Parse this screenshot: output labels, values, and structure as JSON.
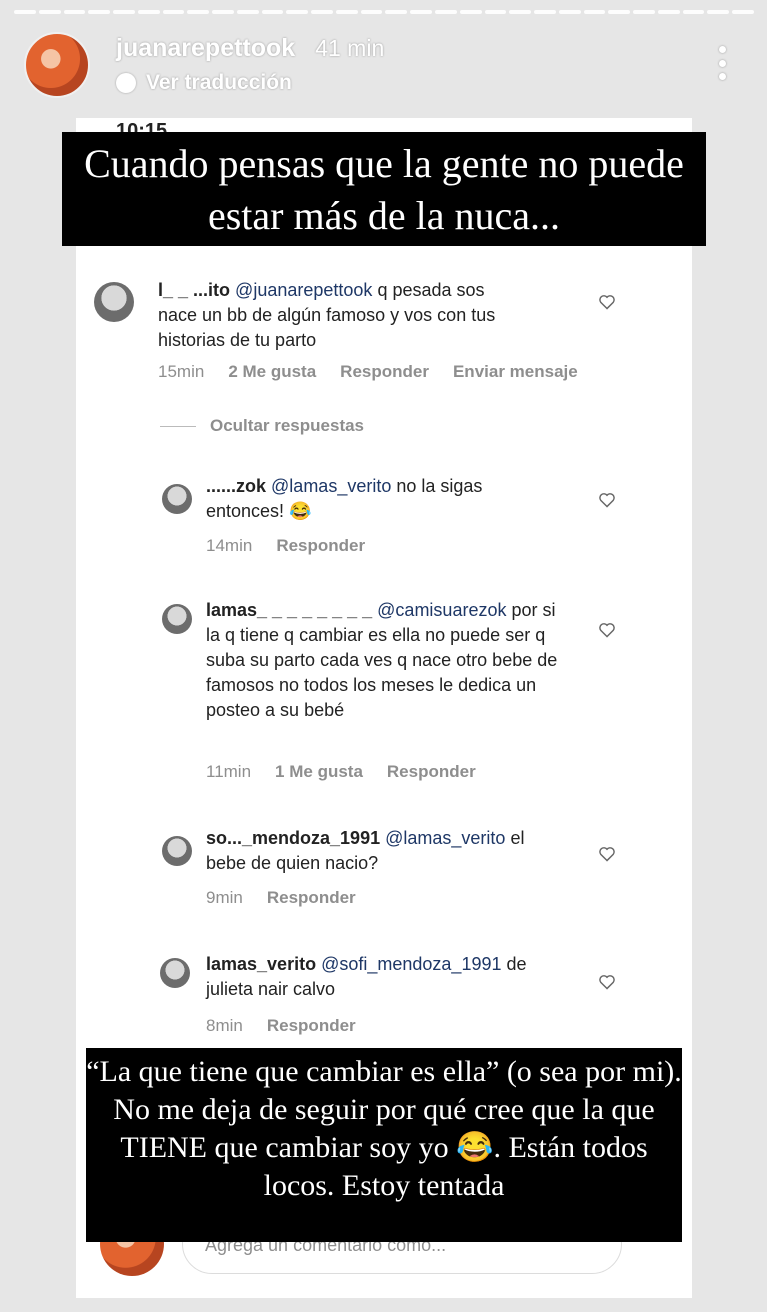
{
  "story": {
    "username": "juanarepettook",
    "time": "41 min",
    "translate": "Ver traducción",
    "status_time": "10:15",
    "caption_top": "Cuando pensas que la gente no puede estar más de la nuca...",
    "caption_bottom": "“La que tiene que cambiar es ella” (o sea por mi). No me deja de seguir por qué cree que la que TIENE que cambiar soy yo 😂. Están todos locos. Estoy tentada"
  },
  "comments": [
    {
      "user": "l_ _ ...ito",
      "mention": "@juanarepettook",
      "text": "q pesada sos nace un bb de algún famoso y vos con tus historias de tu parto",
      "time": "15min",
      "likes": "2 Me gusta",
      "reply": "Responder",
      "message": "Enviar mensaje"
    },
    {
      "user": "......zok",
      "mention": "@lamas_verito",
      "text": "no la sigas entonces! 😂",
      "time": "14min",
      "reply": "Responder"
    },
    {
      "user": "lamas_ _ _ _ _ _ _ _",
      "mention": "@camisuarezok",
      "text": "por si la q tiene q cambiar es ella no puede ser q suba su parto cada ves q nace otro bebe de famosos no todos los meses le dedica un posteo a su bebé",
      "time": "11min",
      "likes": "1 Me gusta",
      "reply": "Responder"
    },
    {
      "user": "so..._mendoza_1991",
      "mention": "@lamas_verito",
      "text": "el bebe de quien nacio?",
      "time": "9min",
      "reply": "Responder"
    },
    {
      "user": "lamas_verito",
      "mention": "@sofi_mendoza_1991",
      "text": "de julieta nair calvo",
      "time": "8min",
      "reply": "Responder"
    }
  ],
  "hide_replies": "Ocultar respuestas",
  "add_comment_placeholder": "Agrega un comentario como..."
}
